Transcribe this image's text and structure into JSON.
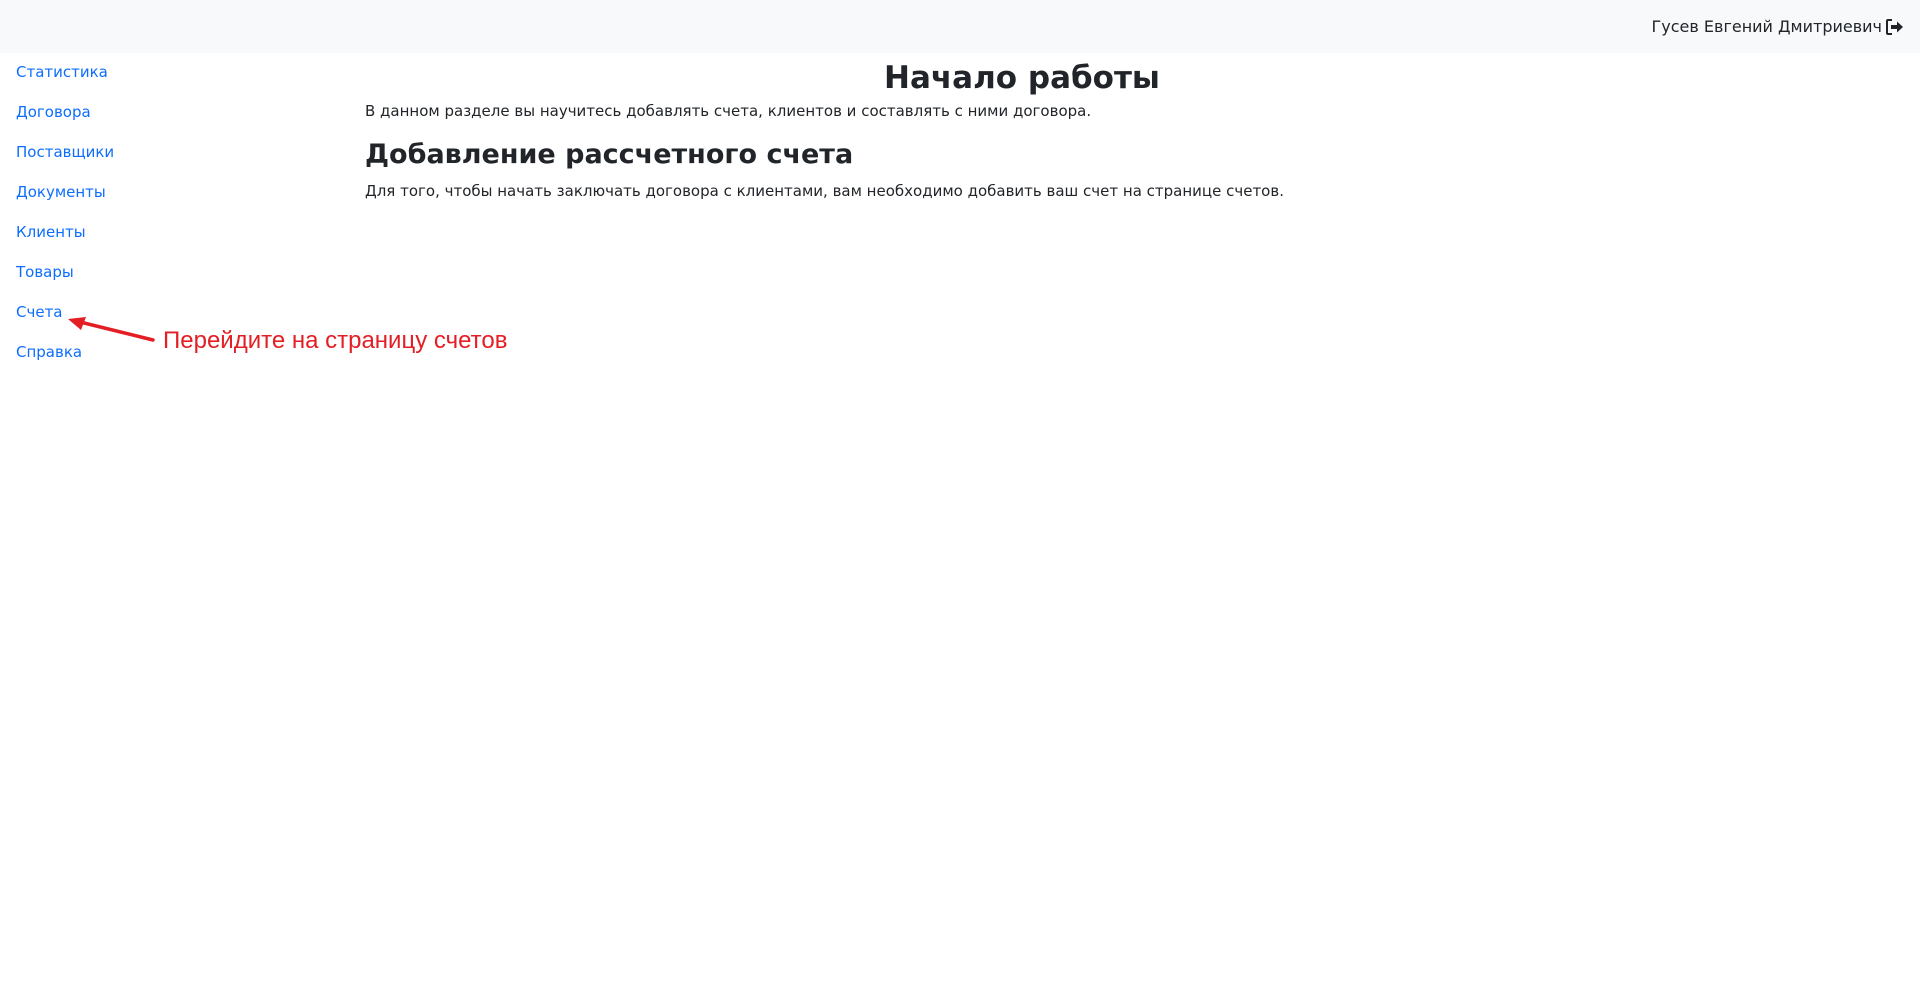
{
  "header": {
    "user_name": "Гусев Евгений Дмитриевич",
    "logout_icon": "logout-icon"
  },
  "sidebar": {
    "items": [
      {
        "label": "Статистика"
      },
      {
        "label": "Договора"
      },
      {
        "label": "Поставщики"
      },
      {
        "label": "Документы"
      },
      {
        "label": "Клиенты"
      },
      {
        "label": "Товары"
      },
      {
        "label": "Счета"
      },
      {
        "label": "Справка"
      }
    ]
  },
  "main": {
    "title": "Начало работы",
    "intro": "В данном разделе вы научитесь добавлять счета, клиентов и составлять с ними договора.",
    "section_title": "Добавление рассчетного счета",
    "section_text": "Для того, чтобы начать заключать договора с клиентами, вам необходимо добавить ваш счет на странице счетов."
  },
  "annotation": {
    "text": "Перейдите на страницу счетов",
    "color": "#e31e24"
  },
  "colors": {
    "link": "#0d6efd",
    "topbar_bg": "#f8f9fa",
    "text": "#212529"
  }
}
